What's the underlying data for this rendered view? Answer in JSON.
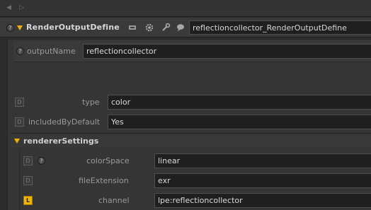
{
  "nav": {
    "back_glyph": "◀",
    "forward_glyph": "▷"
  },
  "node": {
    "type": "RenderOutputDefine",
    "name": "reflectioncollector_RenderOutputDefine",
    "help_glyph": "?",
    "icons": [
      "tag-icon",
      "gear-icon",
      "wrench-icon",
      "comment-icon"
    ]
  },
  "params": {
    "outputName": {
      "label": "outputName",
      "value": "reflectioncollector"
    },
    "type": {
      "label": "type",
      "value": "color",
      "badge": "D"
    },
    "includedByDefault": {
      "label": "includedByDefault",
      "value": "Yes",
      "badge": "D"
    }
  },
  "rendererSettings": {
    "title": "rendererSettings",
    "colorSpace": {
      "label": "colorSpace",
      "value": "linear",
      "badge": "D"
    },
    "fileExtension": {
      "label": "fileExtension",
      "value": "exr",
      "badge": "D"
    },
    "channel": {
      "label": "channel",
      "value": "lpe:reflectioncollector",
      "badge": "L"
    }
  },
  "colors": {
    "accent": "#f0b400",
    "field_bg": "#1f1f1f",
    "panel_bg": "#353535"
  }
}
